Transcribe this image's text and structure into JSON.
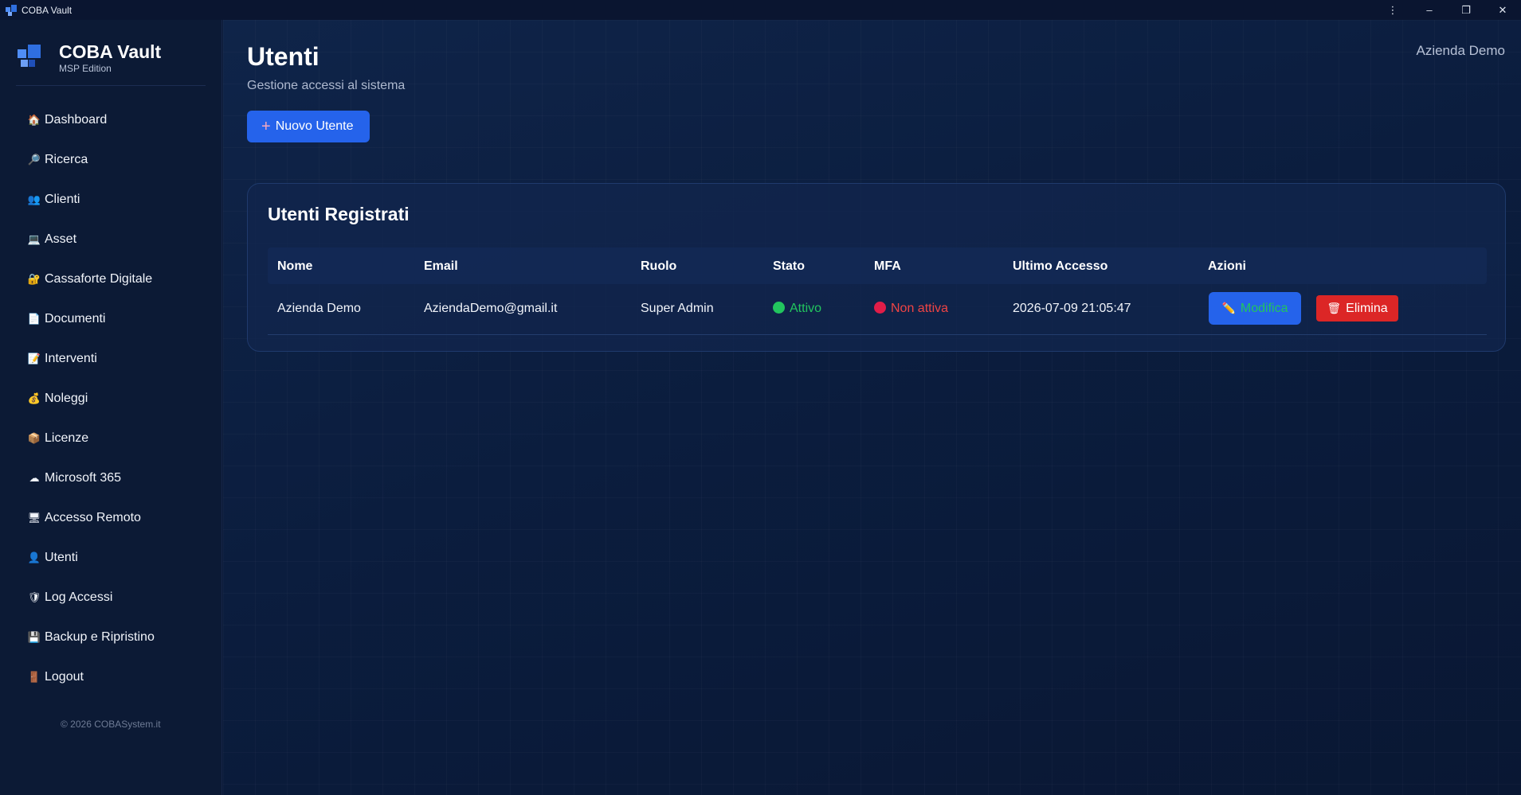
{
  "window": {
    "title": "COBA Vault",
    "controls": [
      "more-icon",
      "minimize-icon",
      "restore-icon",
      "close-icon"
    ]
  },
  "sidebar": {
    "brand": {
      "name": "COBA Vault",
      "edition": "MSP Edition"
    },
    "items": [
      {
        "label": "Dashboard",
        "icon": "house-icon"
      },
      {
        "label": "Ricerca",
        "icon": "magnifier-icon"
      },
      {
        "label": "Clienti",
        "icon": "people-icon"
      },
      {
        "label": "Asset",
        "icon": "laptop-icon"
      },
      {
        "label": "Cassaforte Digitale",
        "icon": "lock-icon"
      },
      {
        "label": "Documenti",
        "icon": "document-icon"
      },
      {
        "label": "Interventi",
        "icon": "memo-icon"
      },
      {
        "label": "Noleggi",
        "icon": "money-bag-icon"
      },
      {
        "label": "Licenze",
        "icon": "package-icon"
      },
      {
        "label": "Microsoft 365",
        "icon": "cloud-icon"
      },
      {
        "label": "Accesso Remoto",
        "icon": "remote-icon"
      },
      {
        "label": "Utenti",
        "icon": "user-icon"
      },
      {
        "label": "Log Accessi",
        "icon": "shield-icon"
      },
      {
        "label": "Backup e Ripristino",
        "icon": "floppy-icon"
      },
      {
        "label": "Logout",
        "icon": "door-icon"
      }
    ],
    "footer": "© 2026 COBASystem.it"
  },
  "header": {
    "title": "Utenti",
    "subtitle": "Gestione accessi al sistema",
    "current_user": "Azienda Demo",
    "new_button": "Nuovo Utente"
  },
  "users_card": {
    "title": "Utenti Registrati",
    "columns": [
      "Nome",
      "Email",
      "Ruolo",
      "Stato",
      "MFA",
      "Ultimo Accesso",
      "Azioni"
    ],
    "rows": [
      {
        "name": "Azienda Demo",
        "email": "AziendaDemo@gmail.it",
        "role": "Super Admin",
        "status": "Attivo",
        "mfa": "Non attiva",
        "last_access": "2026-07-09 21:05:47",
        "edit_label": "Modifica",
        "delete_label": "Elimina"
      }
    ]
  },
  "colors": {
    "accent": "#2563eb",
    "active": "#22c55e",
    "inactive": "#ef4444",
    "danger": "#dc2626"
  }
}
